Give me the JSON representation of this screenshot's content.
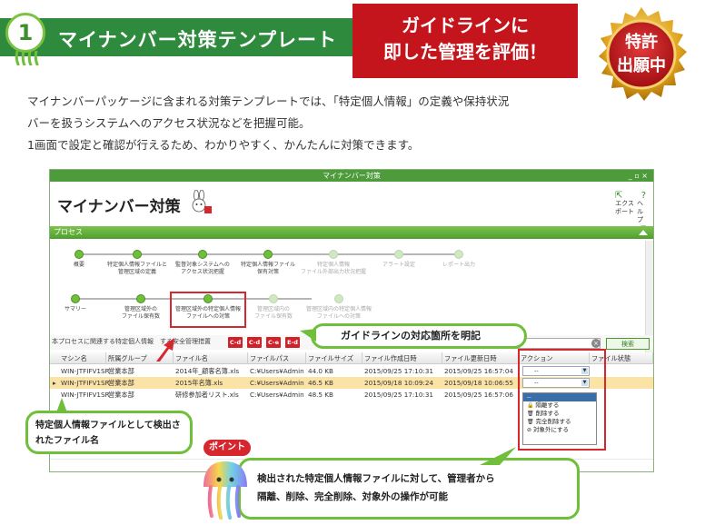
{
  "header": {
    "number": "1",
    "title": "マイナンバー対策テンプレート",
    "red_line1": "ガイドラインに",
    "red_line2": "即した管理を評価！",
    "seal_line1": "特許",
    "seal_line2": "出願中"
  },
  "intro": {
    "line1": "マイナンバーパッケージに含まれる対策テンプレートでは、「特定個人情報」の定義や保持状況",
    "line2": "バーを扱うシステムへのアクセス状況などを把握可能。",
    "line3": "1画面で設定と確認が行えるため、わかりやすく、かんたんに対策できます。"
  },
  "window": {
    "titlebar": "マイナンバー対策",
    "controls": "_ ▫ ×",
    "app_title": "マイナンバー対策",
    "export_label": "エクス\nポート",
    "help_label": "ヘルプ",
    "process_label": "プロセス",
    "steps_top": [
      {
        "label": "概要",
        "active": true
      },
      {
        "label": "特定個人情報ファイルと\n管理区域の定義",
        "active": true
      },
      {
        "label": "監督対象システムへの\nアクセス状況把握",
        "active": true
      },
      {
        "label": "特定個人情報ファイル\n保有対策",
        "active": true
      },
      {
        "label": "特定個人情報\nファイル外部出力状況把握",
        "active": false
      },
      {
        "label": "アラート設定",
        "active": false
      },
      {
        "label": "レポート出力",
        "active": false
      }
    ],
    "steps_sub": [
      {
        "label": "サマリー",
        "active": true
      },
      {
        "label": "管理区域外の\nファイル保有数",
        "active": true
      },
      {
        "label": "管理区域外の特定個人情報\nファイルへの対策",
        "active": true
      },
      {
        "label": "管理区域内の\nファイル保有数",
        "active": false
      },
      {
        "label": "管理区域内の特定個人情報\nファイルへの対策",
        "active": false
      }
    ],
    "filter_text": "本プロセスに関連する特定個人情報　する安全管理措置",
    "tags": [
      "C-d",
      "C-d",
      "C-e",
      "E-d"
    ],
    "search_button": "検索",
    "columns": [
      "マシン名",
      "所属グループ",
      "ファイル名",
      "ファイルパス",
      "ファイルサイズ",
      "ファイル作成日時",
      "ファイル更新日時",
      "アクション",
      "ファイル状態"
    ],
    "rows": [
      {
        "machine": "WIN-JTFIFV1SR",
        "group": "営業本部",
        "file": "2014年_顧客名簿.xls",
        "path": "C:¥Users¥Admin",
        "size": "44.0 KB",
        "created": "2015/09/25 17:10:31",
        "updated": "2015/09/25 16:57:04",
        "action": "--",
        "selected": false
      },
      {
        "machine": "WIN-JTFIFV1SR",
        "group": "営業本部",
        "file": "2015年名簿.xls",
        "path": "C:¥Users¥Admin",
        "size": "46.5 KB",
        "created": "2015/09/18 10:09:24",
        "updated": "2015/09/18 10:06:55",
        "action": "--",
        "selected": true
      },
      {
        "machine": "WIN-JTFIFV1SR",
        "group": "営業本部",
        "file": "研修参加者リスト.xls",
        "path": "C:¥Users¥Admin",
        "size": "48.5 KB",
        "created": "2015/09/25 17:10:31",
        "updated": "2015/09/25 16:57:06",
        "action": "",
        "selected": false
      }
    ],
    "dropdown_options": [
      "--",
      "隔離する",
      "削除する",
      "完全削除する",
      "対象外にする"
    ]
  },
  "callouts": {
    "top": "ガイドラインの対応箇所を明記",
    "left": "特定個人情報ファイルとして検出されたファイル名",
    "point": "ポイント",
    "bottom_line1": "検出された特定個人情報ファイルに対して、管理者から",
    "bottom_line2": "隔離、削除、完全削除、対象外の操作が可能"
  }
}
